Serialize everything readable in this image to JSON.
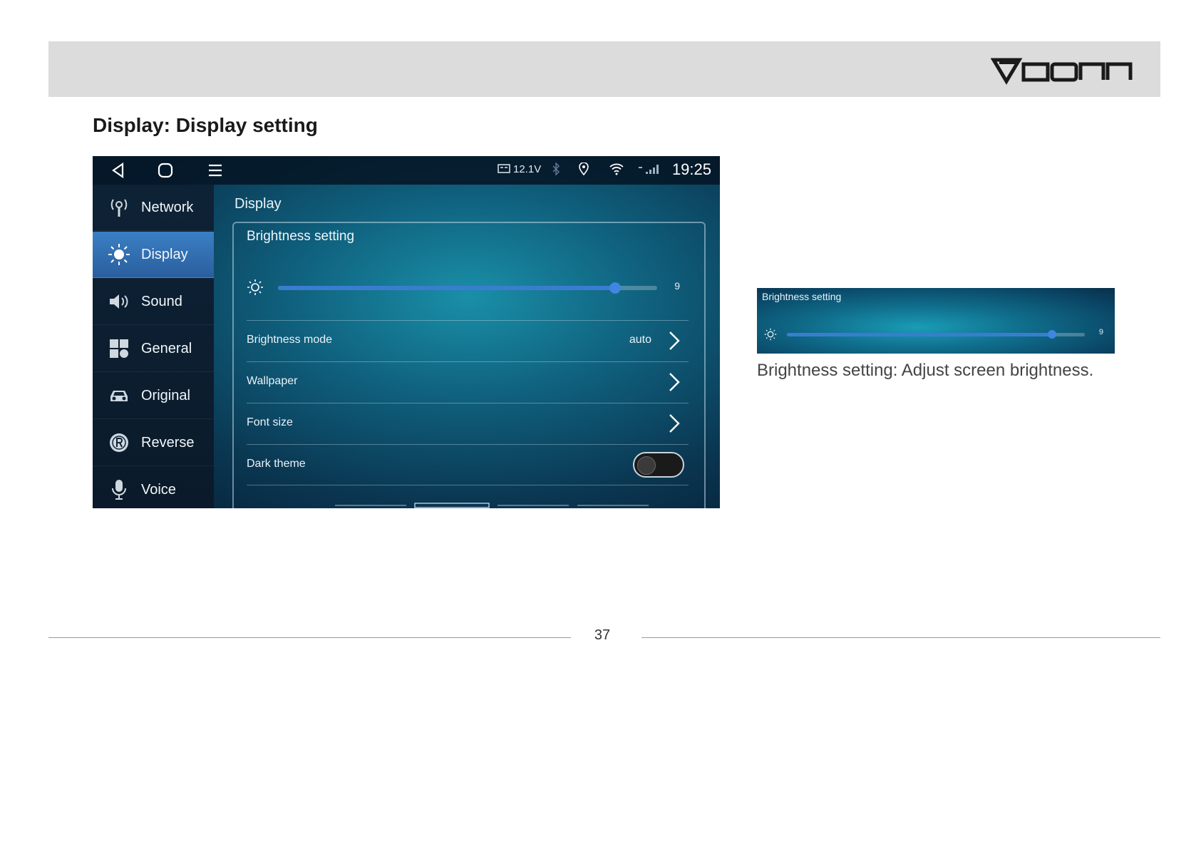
{
  "header": {
    "brand": "Eonon"
  },
  "page": {
    "title": "Display: Display setting",
    "number": "37"
  },
  "screen": {
    "status": {
      "voltage": "12.1V",
      "time": "19:25"
    },
    "sidebar": [
      {
        "label": "Network",
        "icon": "network-icon",
        "active": false
      },
      {
        "label": "Display",
        "icon": "brightness-icon",
        "active": true
      },
      {
        "label": "Sound",
        "icon": "speaker-icon",
        "active": false
      },
      {
        "label": "General",
        "icon": "grid-icon",
        "active": false
      },
      {
        "label": "Original",
        "icon": "car-icon",
        "active": false
      },
      {
        "label": "Reverse",
        "icon": "reverse-icon",
        "active": false
      },
      {
        "label": "Voice",
        "icon": "microphone-icon",
        "active": false
      }
    ],
    "content_title": "Display",
    "brightness": {
      "title": "Brightness setting",
      "value": "9",
      "level_fraction": 0.89
    },
    "rows": [
      {
        "label": "Brightness mode",
        "value": "auto"
      },
      {
        "label": "Wallpaper",
        "value": ""
      },
      {
        "label": "Font size",
        "value": ""
      },
      {
        "label": "Dark theme",
        "value": ""
      }
    ],
    "dark_theme_on": false
  },
  "detail": {
    "crop_title": "Brightness setting",
    "crop_value": "9",
    "caption": "Brightness setting: Adjust screen brightness."
  },
  "colors": {
    "accent": "#3a7dd0",
    "header_band": "#dcdcdc",
    "active_tab": "#3b7fc4"
  }
}
